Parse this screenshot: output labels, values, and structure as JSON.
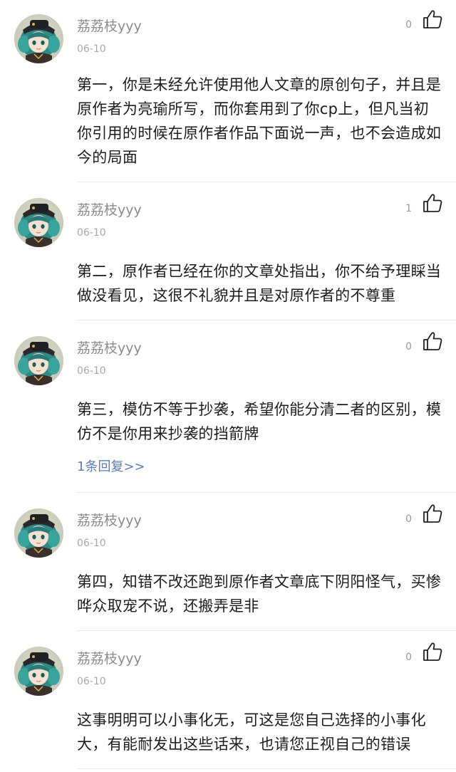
{
  "comments": [
    {
      "username": "荔荔枝yyy",
      "date": "06-10",
      "likes": "0",
      "text": "第一，你是未经允许使用他人文章的原创句子，并且是原作者为亮瑜所写，而你套用到了你cp上，但凡当初你引用的时候在原作者作品下面说一声，也不会造成如今的局面"
    },
    {
      "username": "荔荔枝yyy",
      "date": "06-10",
      "likes": "1",
      "text": "第二，原作者已经在你的文章处指出，你不给予理睬当做没看见，这很不礼貌并且是对原作者的不尊重"
    },
    {
      "username": "荔荔枝yyy",
      "date": "06-10",
      "likes": "0",
      "text": "第三，模仿不等于抄袭，希望你能分清二者的区别，模仿不是你用来抄袭的挡箭牌",
      "replies": "1条回复>>"
    },
    {
      "username": "荔荔枝yyy",
      "date": "06-10",
      "likes": "0",
      "text": "第四，知错不改还跑到原作者文章底下阴阳怪气，买惨哗众取宠不说，还搬弄是非"
    },
    {
      "username": "荔荔枝yyy",
      "date": "06-10",
      "likes": "0",
      "text": "这事明明可以小事化无，可这是您自己选择的小事化大，有能耐发出这些话来，也请您正视自己的错误"
    }
  ],
  "icons": {
    "avatar": "anime-avatar",
    "like": "thumbs-up-icon"
  },
  "colors": {
    "username": "#8b8b8b",
    "date": "#a8a8a8",
    "text": "#1c1c1c",
    "link": "#5b7db3",
    "divider": "#ececec"
  }
}
